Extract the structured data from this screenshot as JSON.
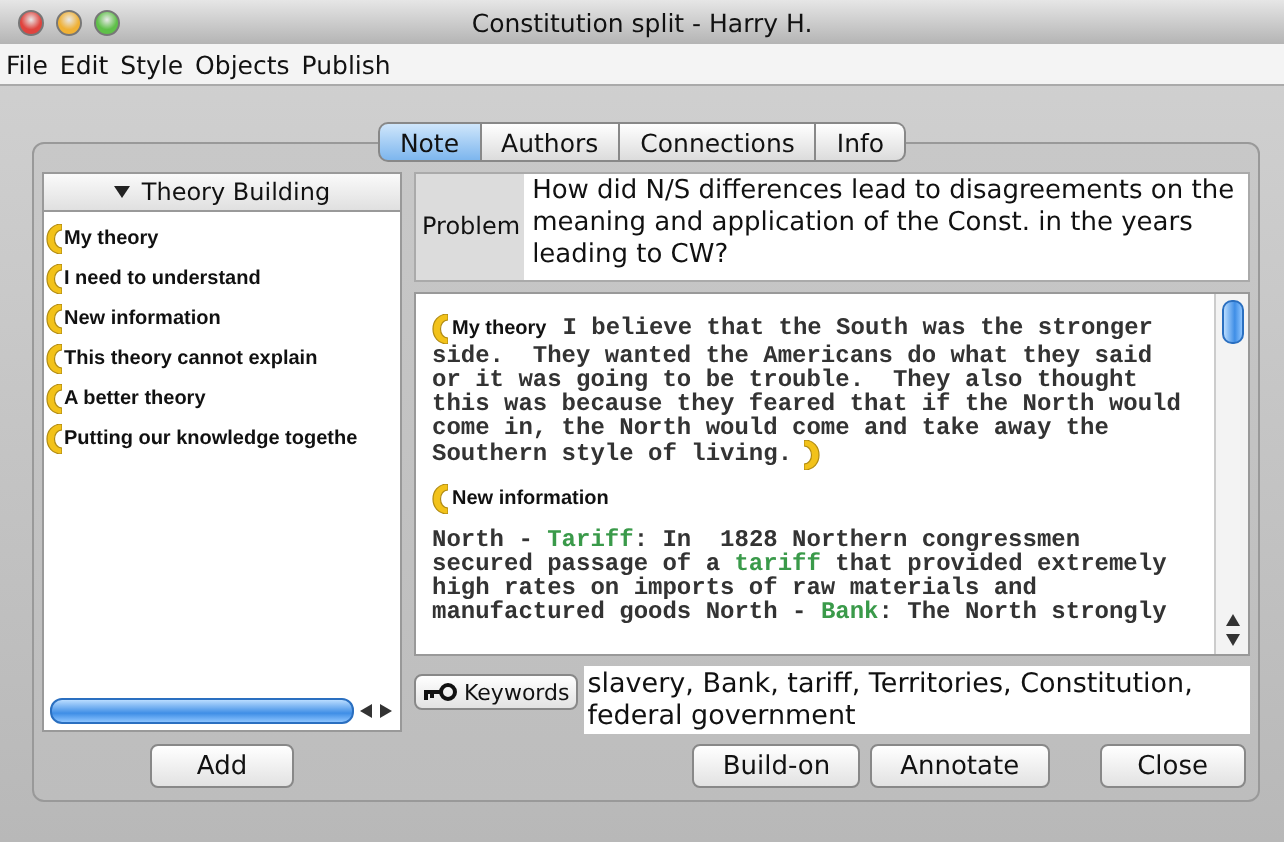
{
  "window": {
    "title": "Constitution split - Harry H."
  },
  "menu": [
    "File",
    "Edit",
    "Style",
    "Objects",
    "Publish"
  ],
  "tabs": [
    {
      "label": "Note",
      "selected": true
    },
    {
      "label": "Authors",
      "selected": false
    },
    {
      "label": "Connections",
      "selected": false
    },
    {
      "label": "Info",
      "selected": false
    }
  ],
  "scaffold_panel": {
    "title": "Theory Building",
    "expanded": true,
    "items": [
      "My theory",
      "I need to understand",
      "New information",
      "This theory cannot explain",
      "A better theory",
      "Putting our knowledge togethe"
    ],
    "add_button": "Add"
  },
  "problem": {
    "label": "Problem",
    "text": "How did N/S differences lead to disagreements on the meaning and application of the Const. in the years leading to CW?"
  },
  "note_body": [
    {
      "kind": "scaffold",
      "label": "My theory",
      "closed": true,
      "lines": [
        "I believe that the South was the stronger",
        "side.  They wanted the Americans do what they said",
        "or it was going to be trouble.  They also thought",
        "this was because they feared that if the North would",
        "come in, the North would come and take away the",
        "Southern style of living."
      ]
    },
    {
      "kind": "scaffold",
      "label": "New information",
      "closed": false
    },
    {
      "kind": "paragraph",
      "lines": [
        [
          {
            "text": "North - ",
            "keyword": false
          },
          {
            "text": "Tariff",
            "keyword": true
          },
          {
            "text": ": In  1828 Northern congressmen",
            "keyword": false
          }
        ],
        [
          {
            "text": "secured passage of a ",
            "keyword": false
          },
          {
            "text": "tariff",
            "keyword": true
          },
          {
            "text": " that provided extremely",
            "keyword": false
          }
        ],
        [
          {
            "text": "high rates on imports of raw materials and",
            "keyword": false
          }
        ],
        [
          {
            "text": "manufactured goods North - ",
            "keyword": false
          },
          {
            "text": "Bank",
            "keyword": true
          },
          {
            "text": ": The North strongly",
            "keyword": false
          }
        ]
      ]
    }
  ],
  "keywords": {
    "button": "Keywords",
    "value": "slavery, Bank, tariff, Territories, Constitution, federal government"
  },
  "buttons": [
    "Build-on",
    "Annotate",
    "Close"
  ]
}
